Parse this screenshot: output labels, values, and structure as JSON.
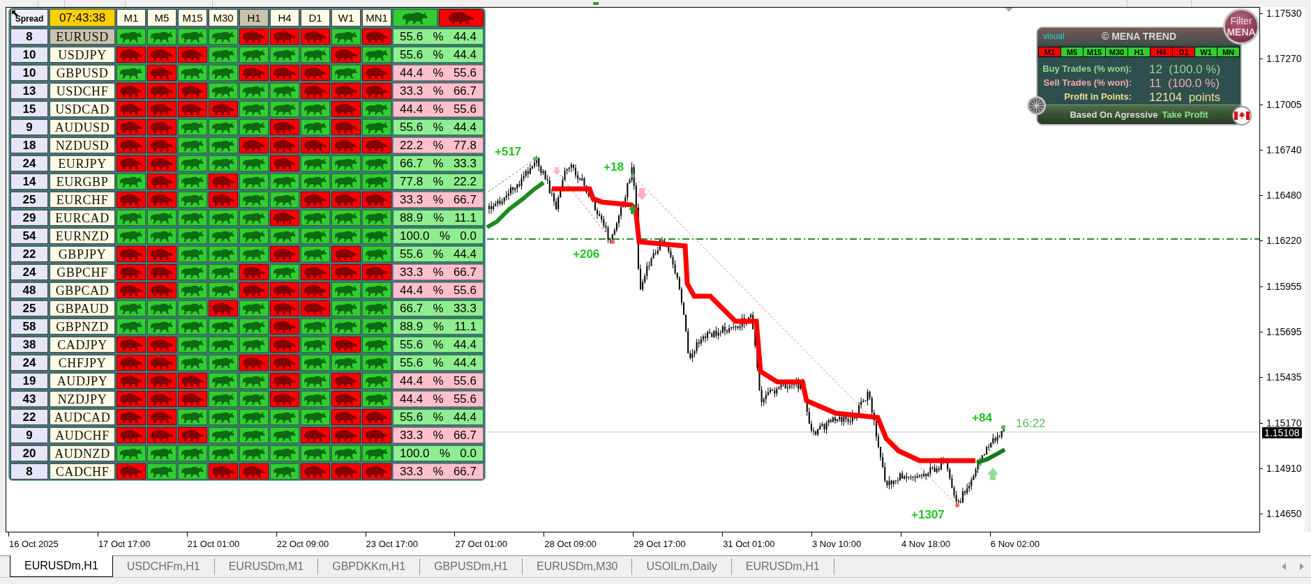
{
  "dashboard": {
    "spread_header": "Spread",
    "clock": "07:43:38",
    "timeframes": [
      {
        "label": "M1",
        "selected": false
      },
      {
        "label": "M5",
        "selected": false
      },
      {
        "label": "M15",
        "selected": false
      },
      {
        "label": "M30",
        "selected": false
      },
      {
        "label": "H1",
        "selected": true
      },
      {
        "label": "H4",
        "selected": false
      },
      {
        "label": "D1",
        "selected": false
      },
      {
        "label": "W1",
        "selected": false
      },
      {
        "label": "MN1",
        "selected": false
      }
    ],
    "summary_columns": [
      {
        "kind": "bull"
      },
      {
        "kind": "bear"
      }
    ],
    "rows": [
      {
        "spread": "8",
        "symbol": "EURUSD",
        "selected": true,
        "signals": [
          {
            "bullish": true
          },
          {
            "bullish": true
          },
          {
            "bullish": true
          },
          {
            "bullish": true
          },
          {
            "bullish": false
          },
          {
            "bullish": false
          },
          {
            "bullish": false
          },
          {
            "bullish": true
          },
          {
            "bullish": false
          }
        ],
        "majority_bullish": true,
        "bull_pct": "55.6",
        "sign": "%",
        "bear_pct": "44.4"
      },
      {
        "spread": "10",
        "symbol": "USDJPY",
        "selected": false,
        "signals": [
          {
            "bullish": false
          },
          {
            "bullish": false
          },
          {
            "bullish": false
          },
          {
            "bullish": true
          },
          {
            "bullish": true
          },
          {
            "bullish": true
          },
          {
            "bullish": true
          },
          {
            "bullish": false
          },
          {
            "bullish": true
          }
        ],
        "majority_bullish": true,
        "bull_pct": "55.6",
        "sign": "%",
        "bear_pct": "44.4"
      },
      {
        "spread": "10",
        "symbol": "GBPUSD",
        "selected": false,
        "signals": [
          {
            "bullish": true
          },
          {
            "bullish": false
          },
          {
            "bullish": true
          },
          {
            "bullish": true
          },
          {
            "bullish": false
          },
          {
            "bullish": false
          },
          {
            "bullish": false
          },
          {
            "bullish": true
          },
          {
            "bullish": false
          }
        ],
        "majority_bullish": false,
        "bull_pct": "44.4",
        "sign": "%",
        "bear_pct": "55.6"
      },
      {
        "spread": "13",
        "symbol": "USDCHF",
        "selected": false,
        "signals": [
          {
            "bullish": false
          },
          {
            "bullish": false
          },
          {
            "bullish": false
          },
          {
            "bullish": true
          },
          {
            "bullish": true
          },
          {
            "bullish": true
          },
          {
            "bullish": false
          },
          {
            "bullish": false
          },
          {
            "bullish": false
          }
        ],
        "majority_bullish": false,
        "bull_pct": "33.3",
        "sign": "%",
        "bear_pct": "66.7"
      },
      {
        "spread": "15",
        "symbol": "USDCAD",
        "selected": false,
        "signals": [
          {
            "bullish": false
          },
          {
            "bullish": false
          },
          {
            "bullish": false
          },
          {
            "bullish": false
          },
          {
            "bullish": true
          },
          {
            "bullish": true
          },
          {
            "bullish": true
          },
          {
            "bullish": false
          },
          {
            "bullish": true
          }
        ],
        "majority_bullish": false,
        "bull_pct": "44.4",
        "sign": "%",
        "bear_pct": "55.6"
      },
      {
        "spread": "9",
        "symbol": "AUDUSD",
        "selected": false,
        "signals": [
          {
            "bullish": false
          },
          {
            "bullish": false
          },
          {
            "bullish": true
          },
          {
            "bullish": true
          },
          {
            "bullish": true
          },
          {
            "bullish": false
          },
          {
            "bullish": true
          },
          {
            "bullish": false
          },
          {
            "bullish": true
          }
        ],
        "majority_bullish": true,
        "bull_pct": "55.6",
        "sign": "%",
        "bear_pct": "44.4"
      },
      {
        "spread": "18",
        "symbol": "NZDUSD",
        "selected": false,
        "signals": [
          {
            "bullish": false
          },
          {
            "bullish": false
          },
          {
            "bullish": true
          },
          {
            "bullish": true
          },
          {
            "bullish": false
          },
          {
            "bullish": false
          },
          {
            "bullish": false
          },
          {
            "bullish": false
          },
          {
            "bullish": false
          }
        ],
        "majority_bullish": false,
        "bull_pct": "22.2",
        "sign": "%",
        "bear_pct": "77.8"
      },
      {
        "spread": "24",
        "symbol": "EURJPY",
        "selected": false,
        "signals": [
          {
            "bullish": false
          },
          {
            "bullish": false
          },
          {
            "bullish": true
          },
          {
            "bullish": true
          },
          {
            "bullish": true
          },
          {
            "bullish": false
          },
          {
            "bullish": true
          },
          {
            "bullish": true
          },
          {
            "bullish": true
          }
        ],
        "majority_bullish": true,
        "bull_pct": "66.7",
        "sign": "%",
        "bear_pct": "33.3"
      },
      {
        "spread": "14",
        "symbol": "EURGBP",
        "selected": false,
        "signals": [
          {
            "bullish": true
          },
          {
            "bullish": false
          },
          {
            "bullish": true
          },
          {
            "bullish": false
          },
          {
            "bullish": true
          },
          {
            "bullish": true
          },
          {
            "bullish": true
          },
          {
            "bullish": true
          },
          {
            "bullish": true
          }
        ],
        "majority_bullish": true,
        "bull_pct": "77.8",
        "sign": "%",
        "bear_pct": "22.2"
      },
      {
        "spread": "25",
        "symbol": "EURCHF",
        "selected": false,
        "signals": [
          {
            "bullish": false
          },
          {
            "bullish": false
          },
          {
            "bullish": true
          },
          {
            "bullish": false
          },
          {
            "bullish": true
          },
          {
            "bullish": true
          },
          {
            "bullish": false
          },
          {
            "bullish": false
          },
          {
            "bullish": false
          }
        ],
        "majority_bullish": false,
        "bull_pct": "33.3",
        "sign": "%",
        "bear_pct": "66.7"
      },
      {
        "spread": "29",
        "symbol": "EURCAD",
        "selected": false,
        "signals": [
          {
            "bullish": true
          },
          {
            "bullish": true
          },
          {
            "bullish": true
          },
          {
            "bullish": true
          },
          {
            "bullish": true
          },
          {
            "bullish": false
          },
          {
            "bullish": true
          },
          {
            "bullish": true
          },
          {
            "bullish": true
          }
        ],
        "majority_bullish": true,
        "bull_pct": "88.9",
        "sign": "%",
        "bear_pct": "11.1"
      },
      {
        "spread": "54",
        "symbol": "EURNZD",
        "selected": false,
        "signals": [
          {
            "bullish": true
          },
          {
            "bullish": true
          },
          {
            "bullish": true
          },
          {
            "bullish": true
          },
          {
            "bullish": true
          },
          {
            "bullish": true
          },
          {
            "bullish": true
          },
          {
            "bullish": true
          },
          {
            "bullish": true
          }
        ],
        "majority_bullish": true,
        "bull_pct": "100.0",
        "sign": "%",
        "bear_pct": "0.0"
      },
      {
        "spread": "22",
        "symbol": "GBPJPY",
        "selected": false,
        "signals": [
          {
            "bullish": false
          },
          {
            "bullish": false
          },
          {
            "bullish": true
          },
          {
            "bullish": true
          },
          {
            "bullish": true
          },
          {
            "bullish": false
          },
          {
            "bullish": true
          },
          {
            "bullish": false
          },
          {
            "bullish": true
          }
        ],
        "majority_bullish": true,
        "bull_pct": "55.6",
        "sign": "%",
        "bear_pct": "44.4"
      },
      {
        "spread": "24",
        "symbol": "GBPCHF",
        "selected": false,
        "signals": [
          {
            "bullish": false
          },
          {
            "bullish": false
          },
          {
            "bullish": true
          },
          {
            "bullish": true
          },
          {
            "bullish": false
          },
          {
            "bullish": true
          },
          {
            "bullish": false
          },
          {
            "bullish": false
          },
          {
            "bullish": false
          }
        ],
        "majority_bullish": false,
        "bull_pct": "33.3",
        "sign": "%",
        "bear_pct": "66.7"
      },
      {
        "spread": "48",
        "symbol": "GBPCAD",
        "selected": false,
        "signals": [
          {
            "bullish": false
          },
          {
            "bullish": false
          },
          {
            "bullish": true
          },
          {
            "bullish": true
          },
          {
            "bullish": false
          },
          {
            "bullish": false
          },
          {
            "bullish": false
          },
          {
            "bullish": true
          },
          {
            "bullish": true
          }
        ],
        "majority_bullish": false,
        "bull_pct": "44.4",
        "sign": "%",
        "bear_pct": "55.6"
      },
      {
        "spread": "25",
        "symbol": "GBPAUD",
        "selected": false,
        "signals": [
          {
            "bullish": true
          },
          {
            "bullish": true
          },
          {
            "bullish": true
          },
          {
            "bullish": false
          },
          {
            "bullish": true
          },
          {
            "bullish": false
          },
          {
            "bullish": false
          },
          {
            "bullish": true
          },
          {
            "bullish": true
          }
        ],
        "majority_bullish": true,
        "bull_pct": "66.7",
        "sign": "%",
        "bear_pct": "33.3"
      },
      {
        "spread": "58",
        "symbol": "GBPNZD",
        "selected": false,
        "signals": [
          {
            "bullish": true
          },
          {
            "bullish": true
          },
          {
            "bullish": true
          },
          {
            "bullish": true
          },
          {
            "bullish": true
          },
          {
            "bullish": false
          },
          {
            "bullish": true
          },
          {
            "bullish": true
          },
          {
            "bullish": true
          }
        ],
        "majority_bullish": true,
        "bull_pct": "88.9",
        "sign": "%",
        "bear_pct": "11.1"
      },
      {
        "spread": "38",
        "symbol": "CADJPY",
        "selected": false,
        "signals": [
          {
            "bullish": false
          },
          {
            "bullish": false
          },
          {
            "bullish": true
          },
          {
            "bullish": true
          },
          {
            "bullish": true
          },
          {
            "bullish": false
          },
          {
            "bullish": true
          },
          {
            "bullish": false
          },
          {
            "bullish": true
          }
        ],
        "majority_bullish": true,
        "bull_pct": "55.6",
        "sign": "%",
        "bear_pct": "44.4"
      },
      {
        "spread": "24",
        "symbol": "CHFJPY",
        "selected": false,
        "signals": [
          {
            "bullish": false
          },
          {
            "bullish": false
          },
          {
            "bullish": true
          },
          {
            "bullish": true
          },
          {
            "bullish": false
          },
          {
            "bullish": false
          },
          {
            "bullish": true
          },
          {
            "bullish": true
          },
          {
            "bullish": true
          }
        ],
        "majority_bullish": true,
        "bull_pct": "55.6",
        "sign": "%",
        "bear_pct": "44.4"
      },
      {
        "spread": "19",
        "symbol": "AUDJPY",
        "selected": false,
        "signals": [
          {
            "bullish": false
          },
          {
            "bullish": false
          },
          {
            "bullish": false
          },
          {
            "bullish": true
          },
          {
            "bullish": true
          },
          {
            "bullish": false
          },
          {
            "bullish": true
          },
          {
            "bullish": false
          },
          {
            "bullish": true
          }
        ],
        "majority_bullish": false,
        "bull_pct": "44.4",
        "sign": "%",
        "bear_pct": "55.6"
      },
      {
        "spread": "43",
        "symbol": "NZDJPY",
        "selected": false,
        "signals": [
          {
            "bullish": false
          },
          {
            "bullish": false
          },
          {
            "bullish": false
          },
          {
            "bullish": true
          },
          {
            "bullish": true
          },
          {
            "bullish": false
          },
          {
            "bullish": true
          },
          {
            "bullish": false
          },
          {
            "bullish": true
          }
        ],
        "majority_bullish": false,
        "bull_pct": "44.4",
        "sign": "%",
        "bear_pct": "55.6"
      },
      {
        "spread": "22",
        "symbol": "AUDCAD",
        "selected": false,
        "signals": [
          {
            "bullish": false
          },
          {
            "bullish": false
          },
          {
            "bullish": true
          },
          {
            "bullish": true
          },
          {
            "bullish": true
          },
          {
            "bullish": true
          },
          {
            "bullish": true
          },
          {
            "bullish": false
          },
          {
            "bullish": false
          }
        ],
        "majority_bullish": true,
        "bull_pct": "55.6",
        "sign": "%",
        "bear_pct": "44.4"
      },
      {
        "spread": "9",
        "symbol": "AUDCHF",
        "selected": false,
        "signals": [
          {
            "bullish": false
          },
          {
            "bullish": false
          },
          {
            "bullish": false
          },
          {
            "bullish": true
          },
          {
            "bullish": true
          },
          {
            "bullish": true
          },
          {
            "bullish": false
          },
          {
            "bullish": false
          },
          {
            "bullish": false
          }
        ],
        "majority_bullish": false,
        "bull_pct": "33.3",
        "sign": "%",
        "bear_pct": "66.7"
      },
      {
        "spread": "20",
        "symbol": "AUDNZD",
        "selected": false,
        "signals": [
          {
            "bullish": true
          },
          {
            "bullish": true
          },
          {
            "bullish": true
          },
          {
            "bullish": true
          },
          {
            "bullish": true
          },
          {
            "bullish": true
          },
          {
            "bullish": true
          },
          {
            "bullish": true
          },
          {
            "bullish": true
          }
        ],
        "majority_bullish": true,
        "bull_pct": "100.0",
        "sign": "%",
        "bear_pct": "0.0"
      },
      {
        "spread": "8",
        "symbol": "CADCHF",
        "selected": false,
        "signals": [
          {
            "bullish": false
          },
          {
            "bullish": true
          },
          {
            "bullish": true
          },
          {
            "bullish": false
          },
          {
            "bullish": false
          },
          {
            "bullish": true
          },
          {
            "bullish": false
          },
          {
            "bullish": false
          },
          {
            "bullish": false
          }
        ],
        "majority_bullish": false,
        "bull_pct": "33.3",
        "sign": "%",
        "bear_pct": "66.7"
      }
    ]
  },
  "mena_panel": {
    "tag": "visual",
    "title": "© MENA TREND",
    "filter_button": "Filter **MENA**",
    "timeframes": [
      {
        "label": "M1",
        "bullish": false
      },
      {
        "label": "M5",
        "bullish": true
      },
      {
        "label": "M15",
        "bullish": true
      },
      {
        "label": "M30",
        "bullish": true
      },
      {
        "label": "H1",
        "bullish": true
      },
      {
        "label": "H4",
        "bullish": false
      },
      {
        "label": "D1",
        "bullish": false
      },
      {
        "label": "W1",
        "bullish": true
      },
      {
        "label": "MN",
        "bullish": true
      }
    ],
    "stats": [
      {
        "kind": "buy",
        "label": "Buy Trades (% won):",
        "value": "12  (100.0 %)"
      },
      {
        "kind": "sell",
        "label": "Sell Trades (% won):",
        "value": "11  (100.0 %)"
      },
      {
        "kind": "profit",
        "label": "Profit in Points:",
        "value": "12104  points"
      }
    ],
    "footer": {
      "text": "Based On Agressive",
      "highlight": "Take Profit"
    }
  },
  "chart": {
    "labels": [
      {
        "kind": "profit",
        "text": "+517"
      },
      {
        "kind": "profit",
        "text": "+18"
      },
      {
        "kind": "profit",
        "text": "+206"
      },
      {
        "kind": "profit",
        "text": "+84"
      },
      {
        "kind": "timer",
        "text": "16:22"
      },
      {
        "kind": "profit",
        "text": "+1307"
      }
    ],
    "price_axis": [
      "1.17530",
      "1.17270",
      "1.17005",
      "1.16740",
      "1.16480",
      "1.16220",
      "1.15955",
      "1.15695",
      "1.15435",
      "1.15170",
      "1.14910",
      "1.14650"
    ],
    "current_price": "1.15108",
    "time_axis": [
      "16 Oct 2025",
      "17 Oct 17:00",
      "21 Oct 01:00",
      "22 Oct 09:00",
      "23 Oct 17:00",
      "27 Oct 01:00",
      "28 Oct 09:00",
      "29 Oct 17:00",
      "31 Oct 01:00",
      "3 Nov 10:00",
      "4 Nov 18:00",
      "6 Nov 02:00"
    ]
  },
  "tabs": [
    {
      "label": "EURUSDm,H1",
      "selected": true
    },
    {
      "label": "USDCHFm,H1",
      "selected": false
    },
    {
      "label": "EURUSDm,M1",
      "selected": false
    },
    {
      "label": "GBPDKKm,H1",
      "selected": false
    },
    {
      "label": "GBPUSDm,H1",
      "selected": false
    },
    {
      "label": "EURUSDm,M30",
      "selected": false
    },
    {
      "label": "USOILm,Daily",
      "selected": false
    },
    {
      "label": "EURUSDm,H1",
      "selected": false
    }
  ]
}
